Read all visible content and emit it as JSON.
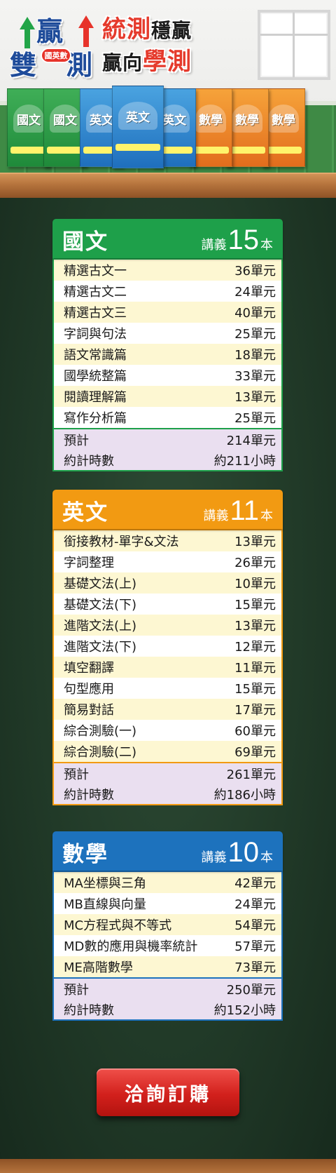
{
  "banner": {
    "logo": {
      "char_ying": "贏",
      "char_shuang": "雙",
      "char_ce": "測",
      "badge": "國英數"
    },
    "slogan": {
      "line1_red": "統測",
      "line1_black": "穩贏",
      "line2_black": "贏向",
      "line2_red": "學測"
    },
    "books": [
      {
        "title": "國文",
        "color": "green"
      },
      {
        "title": "國文",
        "color": "green"
      },
      {
        "title": "英文",
        "color": "blue"
      },
      {
        "title": "英文",
        "color": "blue"
      },
      {
        "title": "英文",
        "color": "blue"
      },
      {
        "title": "數學",
        "color": "orange"
      },
      {
        "title": "數學",
        "color": "orange"
      },
      {
        "title": "數學",
        "color": "orange"
      }
    ]
  },
  "colors": {
    "chinese": "#1ea04a",
    "english": "#f29a12",
    "math": "#1d72bd",
    "total_bg": "#eadff0",
    "alt_row_bg": "#fdf7d2",
    "button": "#d2201c"
  },
  "sections": {
    "chinese": {
      "name": "國文",
      "handout_word": "講義",
      "count": "15",
      "unit": "本",
      "rows": [
        {
          "label": "精選古文一",
          "value": "36單元"
        },
        {
          "label": "精選古文二",
          "value": "24單元"
        },
        {
          "label": "精選古文三",
          "value": "40單元"
        },
        {
          "label": "字詞與句法",
          "value": "25單元"
        },
        {
          "label": "語文常識篇",
          "value": "18單元"
        },
        {
          "label": "國學統整篇",
          "value": "33單元"
        },
        {
          "label": "閱讀理解篇",
          "value": "13單元"
        },
        {
          "label": "寫作分析篇",
          "value": "25單元"
        }
      ],
      "total_label": "預計",
      "total_value": "214單元",
      "hours_label": "約計時數",
      "hours_value": "約211小時"
    },
    "english": {
      "name": "英文",
      "handout_word": "講義",
      "count": "11",
      "unit": "本",
      "rows": [
        {
          "label": "銜接教材-單字&文法",
          "value": "13單元"
        },
        {
          "label": "字詞整理",
          "value": "26單元"
        },
        {
          "label": "基礎文法(上)",
          "value": "10單元"
        },
        {
          "label": "基礎文法(下)",
          "value": "15單元"
        },
        {
          "label": "進階文法(上)",
          "value": "13單元"
        },
        {
          "label": "進階文法(下)",
          "value": "12單元"
        },
        {
          "label": "填空翻譯",
          "value": "11單元"
        },
        {
          "label": "句型應用",
          "value": "15單元"
        },
        {
          "label": "簡易對話",
          "value": "17單元"
        },
        {
          "label": "綜合測驗(一)",
          "value": "60單元"
        },
        {
          "label": "綜合測驗(二)",
          "value": "69單元"
        }
      ],
      "total_label": "預計",
      "total_value": "261單元",
      "hours_label": "約計時數",
      "hours_value": "約186小時"
    },
    "math": {
      "name": "數學",
      "handout_word": "講義",
      "count": "10",
      "unit": "本",
      "rows": [
        {
          "label": "MA坐標與三角",
          "value": "42單元"
        },
        {
          "label": "MB直線與向量",
          "value": "24單元"
        },
        {
          "label": "MC方程式與不等式",
          "value": "54單元"
        },
        {
          "label": "MD數的應用與機率統計",
          "value": "57單元"
        },
        {
          "label": "ME高階數學",
          "value": "73單元"
        }
      ],
      "total_label": "預計",
      "total_value": "250單元",
      "hours_label": "約計時數",
      "hours_value": "約152小時"
    }
  },
  "cta": {
    "label": "洽詢訂購"
  }
}
